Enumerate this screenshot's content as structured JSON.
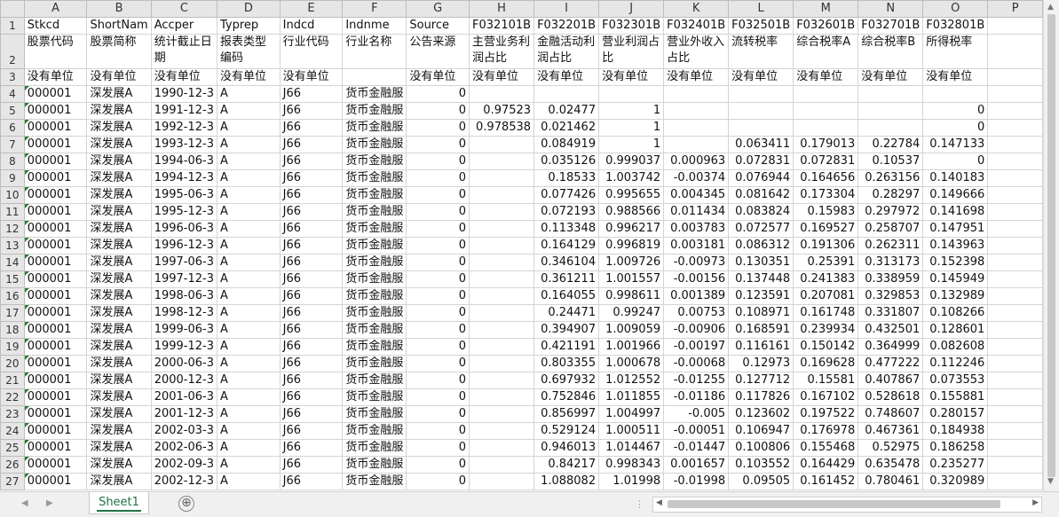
{
  "columns": [
    "A",
    "B",
    "C",
    "D",
    "E",
    "F",
    "G",
    "H",
    "I",
    "J",
    "K",
    "L",
    "M",
    "N",
    "O",
    "P"
  ],
  "row_numbers": [
    "1",
    "2",
    "3",
    "4",
    "5",
    "6",
    "7",
    "8",
    "9",
    "10",
    "11",
    "12",
    "13",
    "14",
    "15",
    "16",
    "17",
    "18",
    "19",
    "20",
    "21",
    "22",
    "23",
    "24",
    "25",
    "26",
    "27"
  ],
  "header_rows": [
    [
      "Stkcd",
      "ShortNam",
      "Accper",
      "Typrep",
      "Indcd",
      "Indnme",
      "Source",
      "F032101B",
      "F032201B",
      "F032301B",
      "F032401B",
      "F032501B",
      "F032601B",
      "F032701B",
      "F032801B",
      ""
    ],
    [
      "股票代码",
      "股票简称",
      "统计截止日期",
      "报表类型编码",
      "行业代码",
      "行业名称",
      "公告来源",
      "主营业务利润占比",
      "金融活动利润占比",
      "营业利润占比",
      "营业外收入占比",
      "流转税率",
      "综合税率A",
      "综合税率B",
      "所得税率",
      ""
    ],
    [
      "没有单位",
      "没有单位",
      "没有单位",
      "没有单位",
      "没有单位",
      "",
      "没有单位",
      "没有单位",
      "没有单位",
      "没有单位",
      "没有单位",
      "没有单位",
      "没有单位",
      "没有单位",
      "没有单位",
      ""
    ]
  ],
  "data_rows": [
    [
      "000001",
      "深发展A",
      "1990-12-3",
      "A",
      "J66",
      "货币金融服",
      "0",
      "",
      "",
      "",
      "",
      "",
      "",
      "",
      "",
      ""
    ],
    [
      "000001",
      "深发展A",
      "1991-12-3",
      "A",
      "J66",
      "货币金融服",
      "0",
      "0.97523",
      "0.02477",
      "1",
      "",
      "",
      "",
      "",
      "0",
      ""
    ],
    [
      "000001",
      "深发展A",
      "1992-12-3",
      "A",
      "J66",
      "货币金融服",
      "0",
      "0.978538",
      "0.021462",
      "1",
      "",
      "",
      "",
      "",
      "0",
      ""
    ],
    [
      "000001",
      "深发展A",
      "1993-12-3",
      "A",
      "J66",
      "货币金融服",
      "0",
      "",
      "0.084919",
      "1",
      "",
      "0.063411",
      "0.179013",
      "0.22784",
      "0.147133",
      ""
    ],
    [
      "000001",
      "深发展A",
      "1994-06-3",
      "A",
      "J66",
      "货币金融服",
      "0",
      "",
      "0.035126",
      "0.999037",
      "0.000963",
      "0.072831",
      "0.072831",
      "0.10537",
      "0",
      ""
    ],
    [
      "000001",
      "深发展A",
      "1994-12-3",
      "A",
      "J66",
      "货币金融服",
      "0",
      "",
      "0.18533",
      "1.003742",
      "-0.00374",
      "0.076944",
      "0.164656",
      "0.263156",
      "0.140183",
      ""
    ],
    [
      "000001",
      "深发展A",
      "1995-06-3",
      "A",
      "J66",
      "货币金融服",
      "0",
      "",
      "0.077426",
      "0.995655",
      "0.004345",
      "0.081642",
      "0.173304",
      "0.28297",
      "0.149666",
      ""
    ],
    [
      "000001",
      "深发展A",
      "1995-12-3",
      "A",
      "J66",
      "货币金融服",
      "0",
      "",
      "0.072193",
      "0.988566",
      "0.011434",
      "0.083824",
      "0.15983",
      "0.297972",
      "0.141698",
      ""
    ],
    [
      "000001",
      "深发展A",
      "1996-06-3",
      "A",
      "J66",
      "货币金融服",
      "0",
      "",
      "0.113348",
      "0.996217",
      "0.003783",
      "0.072577",
      "0.169527",
      "0.258707",
      "0.147951",
      ""
    ],
    [
      "000001",
      "深发展A",
      "1996-12-3",
      "A",
      "J66",
      "货币金融服",
      "0",
      "",
      "0.164129",
      "0.996819",
      "0.003181",
      "0.086312",
      "0.191306",
      "0.262311",
      "0.143963",
      ""
    ],
    [
      "000001",
      "深发展A",
      "1997-06-3",
      "A",
      "J66",
      "货币金融服",
      "0",
      "",
      "0.346104",
      "1.009726",
      "-0.00973",
      "0.130351",
      "0.25391",
      "0.313173",
      "0.152398",
      ""
    ],
    [
      "000001",
      "深发展A",
      "1997-12-3",
      "A",
      "J66",
      "货币金融服",
      "0",
      "",
      "0.361211",
      "1.001557",
      "-0.00156",
      "0.137448",
      "0.241383",
      "0.338959",
      "0.145949",
      ""
    ],
    [
      "000001",
      "深发展A",
      "1998-06-3",
      "A",
      "J66",
      "货币金融服",
      "0",
      "",
      "0.164055",
      "0.998611",
      "0.001389",
      "0.123591",
      "0.207081",
      "0.329853",
      "0.132989",
      ""
    ],
    [
      "000001",
      "深发展A",
      "1998-12-3",
      "A",
      "J66",
      "货币金融服",
      "0",
      "",
      "0.24471",
      "0.99247",
      "0.00753",
      "0.108971",
      "0.161748",
      "0.331807",
      "0.108266",
      ""
    ],
    [
      "000001",
      "深发展A",
      "1999-06-3",
      "A",
      "J66",
      "货币金融服",
      "0",
      "",
      "0.394907",
      "1.009059",
      "-0.00906",
      "0.168591",
      "0.239934",
      "0.432501",
      "0.128601",
      ""
    ],
    [
      "000001",
      "深发展A",
      "1999-12-3",
      "A",
      "J66",
      "货币金融服",
      "0",
      "",
      "0.421191",
      "1.001966",
      "-0.00197",
      "0.116161",
      "0.150142",
      "0.364999",
      "0.082608",
      ""
    ],
    [
      "000001",
      "深发展A",
      "2000-06-3",
      "A",
      "J66",
      "货币金融服",
      "0",
      "",
      "0.803355",
      "1.000678",
      "-0.00068",
      "0.12973",
      "0.169628",
      "0.477222",
      "0.112246",
      ""
    ],
    [
      "000001",
      "深发展A",
      "2000-12-3",
      "A",
      "J66",
      "货币金融服",
      "0",
      "",
      "0.697932",
      "1.012552",
      "-0.01255",
      "0.127712",
      "0.15581",
      "0.407867",
      "0.073553",
      ""
    ],
    [
      "000001",
      "深发展A",
      "2001-06-3",
      "A",
      "J66",
      "货币金融服",
      "0",
      "",
      "0.752846",
      "1.011855",
      "-0.01186",
      "0.117826",
      "0.167102",
      "0.528618",
      "0.155881",
      ""
    ],
    [
      "000001",
      "深发展A",
      "2001-12-3",
      "A",
      "J66",
      "货币金融服",
      "0",
      "",
      "0.856997",
      "1.004997",
      "-0.005",
      "0.123602",
      "0.197522",
      "0.748607",
      "0.280157",
      ""
    ],
    [
      "000001",
      "深发展A",
      "2002-03-3",
      "A",
      "J66",
      "货币金融服",
      "0",
      "",
      "0.529124",
      "1.000511",
      "-0.00051",
      "0.106947",
      "0.176978",
      "0.467361",
      "0.184938",
      ""
    ],
    [
      "000001",
      "深发展A",
      "2002-06-3",
      "A",
      "J66",
      "货币金融服",
      "0",
      "",
      "0.946013",
      "1.014467",
      "-0.01447",
      "0.100806",
      "0.155468",
      "0.52975",
      "0.186258",
      ""
    ],
    [
      "000001",
      "深发展A",
      "2002-09-3",
      "A",
      "J66",
      "货币金融服",
      "0",
      "",
      "0.84217",
      "0.998343",
      "0.001657",
      "0.103552",
      "0.164429",
      "0.635478",
      "0.235277",
      ""
    ],
    [
      "000001",
      "深发展A",
      "2002-12-3",
      "A",
      "J66",
      "货币金融服",
      "0",
      "",
      "1.088082",
      "1.01998",
      "-0.01998",
      "0.09505",
      "0.161452",
      "0.780461",
      "0.320989",
      ""
    ]
  ],
  "tabs": {
    "active": "Sheet1",
    "add_symbol": "⊕"
  },
  "icons": {
    "nav_prev": "◀",
    "nav_next": "▶",
    "splitter": "⋮"
  }
}
